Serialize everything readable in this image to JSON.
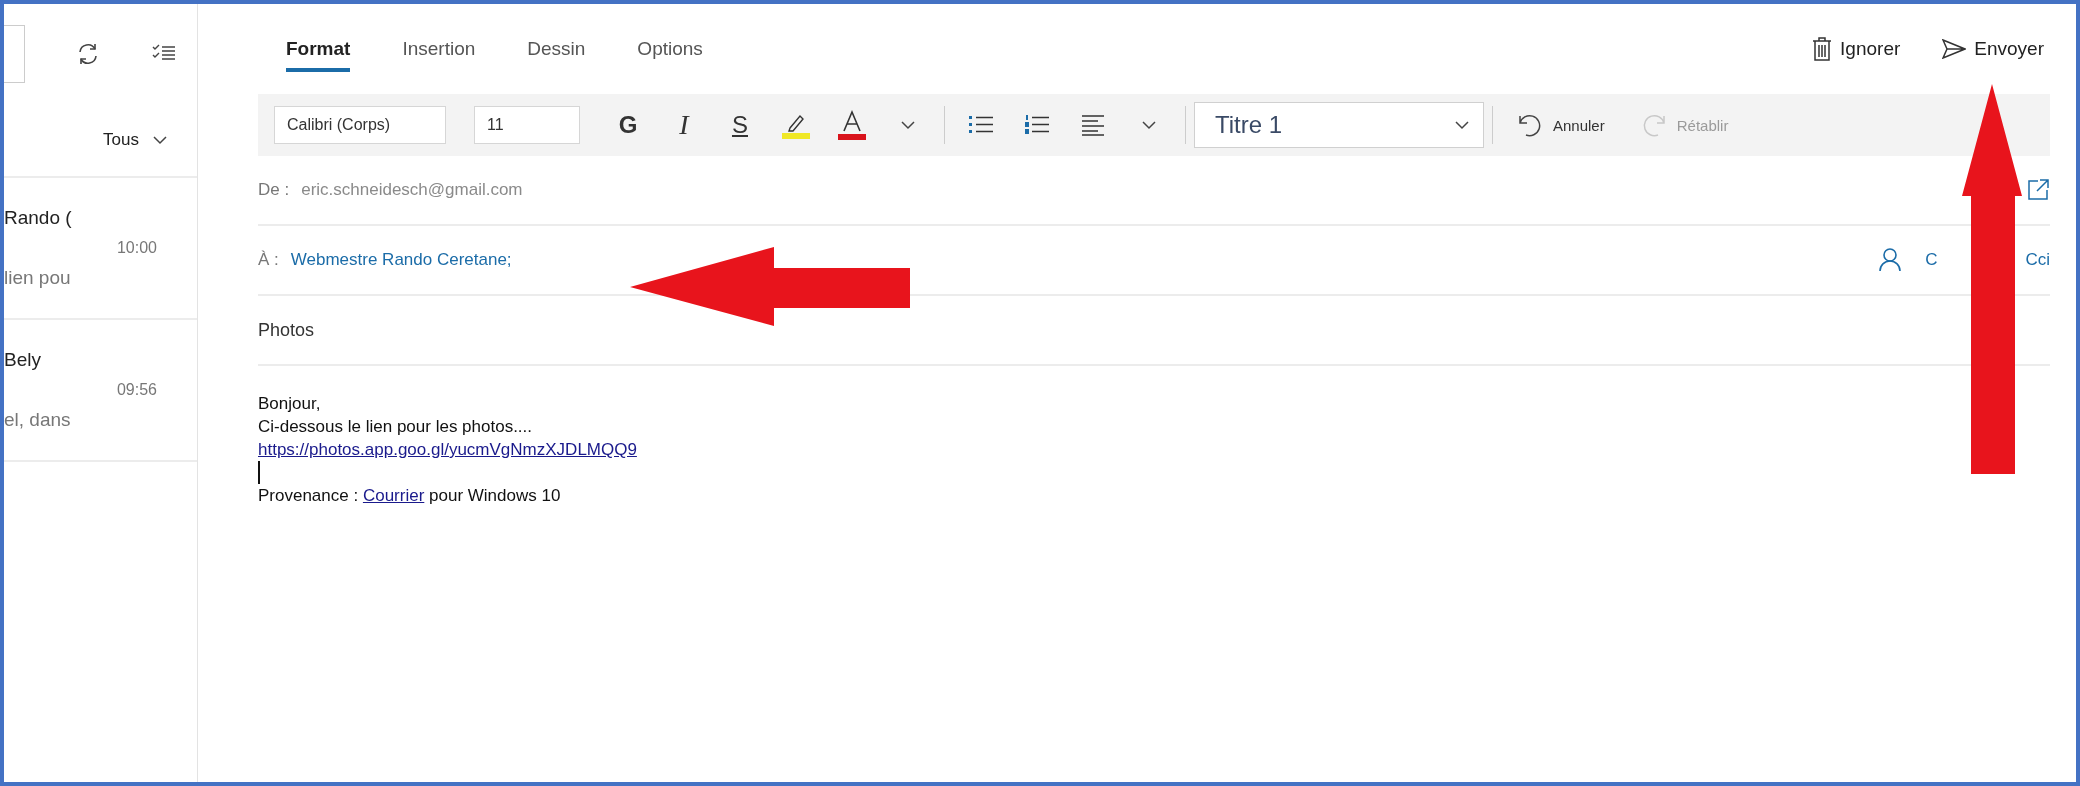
{
  "left_panel": {
    "filter": "Tous",
    "messages": [
      {
        "sender": "Rando (",
        "time": "10:00",
        "preview": "lien pou"
      },
      {
        "sender": "Bely",
        "time": "09:56",
        "preview": "el, dans"
      }
    ]
  },
  "tabs": [
    {
      "label": "Format",
      "selected": true
    },
    {
      "label": "Insertion",
      "selected": false
    },
    {
      "label": "Dessin",
      "selected": false
    },
    {
      "label": "Options",
      "selected": false
    }
  ],
  "actions": [
    {
      "kind": "discard",
      "label": "Ignorer"
    },
    {
      "kind": "send",
      "label": "Envoyer"
    }
  ],
  "toolbar": {
    "font": "Calibri (Corps)",
    "size": "11",
    "bold": "G",
    "italic": "I",
    "underline": "S",
    "style": "Titre 1",
    "history": [
      {
        "kind": "undo",
        "label": "Annuler",
        "disabled": false
      },
      {
        "kind": "redo",
        "label": "Rétablir",
        "disabled": true
      }
    ]
  },
  "fields": {
    "from": {
      "label": "De :",
      "value": "eric.schneidesch@gmail.com"
    },
    "to": {
      "label": "À :",
      "value": "Webmestre Rando Ceretane;",
      "cc": "C",
      "bcc": "Cci"
    },
    "subject": "Photos"
  },
  "body": [
    {
      "kind": "text",
      "text": "Bonjour,"
    },
    {
      "kind": "text",
      "text": "Ci-dessous le lien pour les photos...."
    },
    {
      "kind": "link",
      "text": "https://photos.app.goo.gl/yucmVgNmzXJDLMQQ9"
    },
    {
      "kind": "cursor"
    },
    {
      "kind": "signature",
      "before": "Provenance : ",
      "link": "Courrier",
      "after": " pour Windows 10"
    }
  ]
}
